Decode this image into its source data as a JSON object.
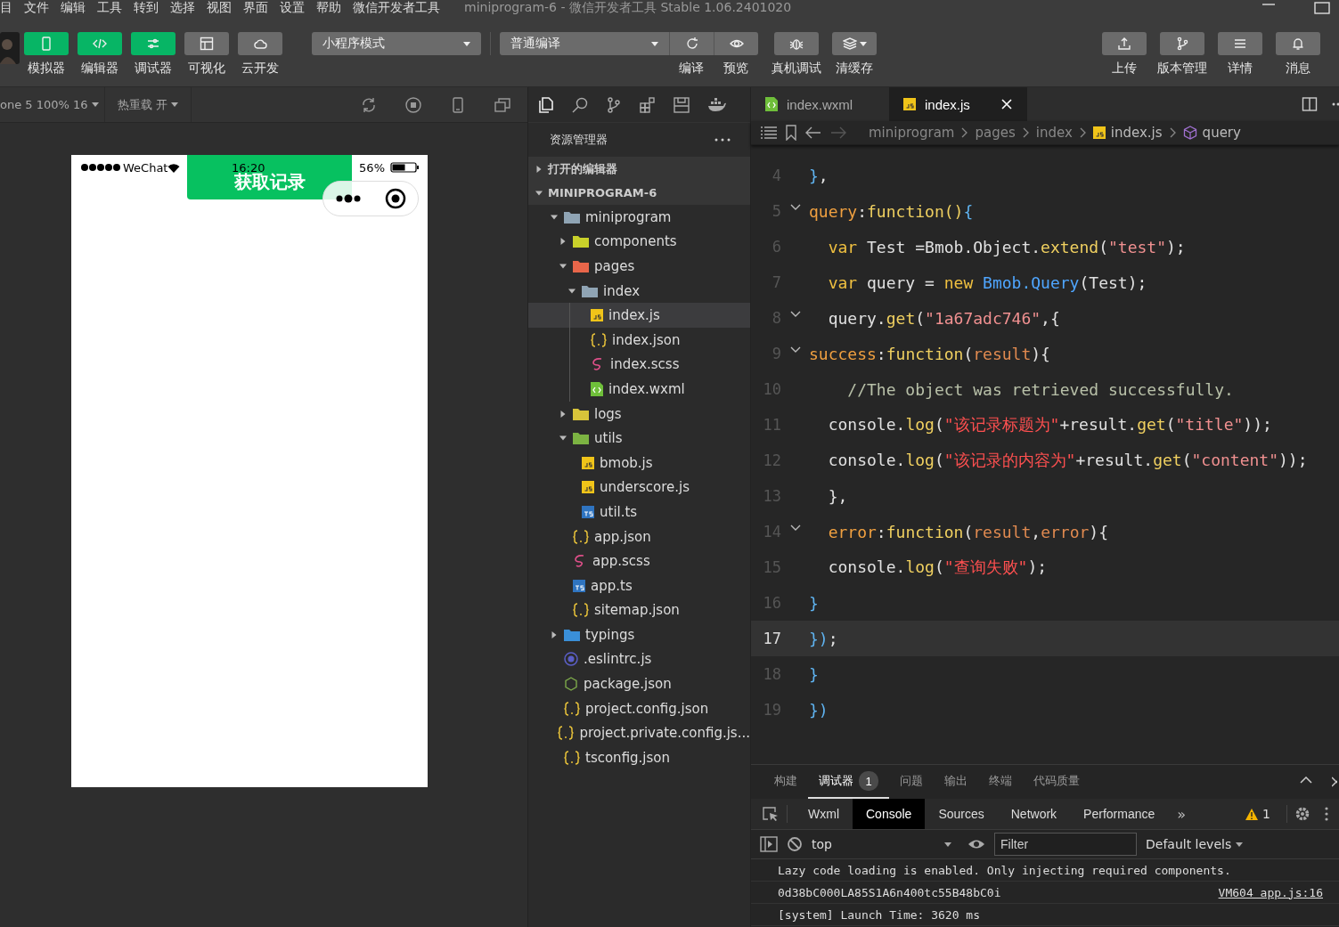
{
  "menu": [
    "目",
    "文件",
    "编辑",
    "工具",
    "转到",
    "选择",
    "视图",
    "界面",
    "设置",
    "帮助",
    "微信开发者工具"
  ],
  "window": {
    "title": "miniprogram-6 - 微信开发者工具 Stable 1.06.2401020"
  },
  "toolbar": {
    "view_buttons": [
      {
        "label": "模拟器",
        "selected": true
      },
      {
        "label": "编辑器",
        "selected": true
      },
      {
        "label": "调试器",
        "selected": true
      },
      {
        "label": "可视化",
        "selected": false
      },
      {
        "label": "云开发",
        "selected": false
      }
    ],
    "mode": "小程序模式",
    "compile_mode": "普通编译",
    "compile_actions": [
      "编译",
      "预览"
    ],
    "actions": [
      "真机调试",
      "清缓存"
    ],
    "right_actions": [
      "上传",
      "版本管理",
      "详情",
      "消息"
    ]
  },
  "simulator": {
    "device": "one 5 100% 16",
    "hot_reload": "热重载 开",
    "phone": {
      "carrier": "WeChat",
      "time": "16:20",
      "battery": "56%",
      "button": "获取记录"
    }
  },
  "explorer": {
    "title": "资源管理器",
    "sections": [
      {
        "label": "打开的编辑器",
        "expanded": false
      },
      {
        "label": "MINIPROGRAM-6",
        "expanded": true
      }
    ],
    "tree": [
      {
        "name": "miniprogram",
        "kind": "folder",
        "color": "#8fa4b4",
        "expanded": true,
        "selected": false,
        "children": [
          {
            "name": "components",
            "kind": "folder",
            "color": "#c9d12a",
            "expanded": false,
            "selected": false
          },
          {
            "name": "pages",
            "kind": "folder",
            "color": "#e8664a",
            "expanded": true,
            "selected": false,
            "children": [
              {
                "name": "index",
                "kind": "folder",
                "color": "#8fa4b4",
                "expanded": true,
                "selected": false,
                "children": [
                  {
                    "name": "index.js",
                    "kind": "js",
                    "selected": true
                  },
                  {
                    "name": "index.json",
                    "kind": "json",
                    "selected": false
                  },
                  {
                    "name": "index.scss",
                    "kind": "scss",
                    "selected": false
                  },
                  {
                    "name": "index.wxml",
                    "kind": "wxml",
                    "selected": false
                  }
                ]
              }
            ]
          },
          {
            "name": "logs",
            "kind": "folder",
            "color": "#d8c43a",
            "expanded": false,
            "selected": false
          },
          {
            "name": "utils",
            "kind": "folder",
            "color": "#7cb342",
            "expanded": true,
            "selected": false,
            "children": [
              {
                "name": "bmob.js",
                "kind": "js",
                "selected": false
              },
              {
                "name": "underscore.js",
                "kind": "js",
                "selected": false
              },
              {
                "name": "util.ts",
                "kind": "ts",
                "selected": false
              }
            ]
          },
          {
            "name": "app.json",
            "kind": "json",
            "selected": false
          },
          {
            "name": "app.scss",
            "kind": "scss",
            "selected": false
          },
          {
            "name": "app.ts",
            "kind": "ts",
            "selected": false
          },
          {
            "name": "sitemap.json",
            "kind": "json",
            "selected": false
          }
        ]
      },
      {
        "name": "typings",
        "kind": "folder",
        "color": "#3a8fd8",
        "expanded": false,
        "selected": false
      },
      {
        "name": ".eslintrc.js",
        "kind": "eslint",
        "selected": false
      },
      {
        "name": "package.json",
        "kind": "npm",
        "selected": false
      },
      {
        "name": "project.config.json",
        "kind": "json",
        "selected": false
      },
      {
        "name": "project.private.config.js...",
        "kind": "json",
        "selected": false
      },
      {
        "name": "tsconfig.json",
        "kind": "json",
        "selected": false
      }
    ]
  },
  "editor": {
    "tabs": [
      {
        "label": "index.wxml",
        "kind": "wxml",
        "selected": false
      },
      {
        "label": "index.js",
        "kind": "js",
        "selected": true
      }
    ],
    "breadcrumb": [
      {
        "label": "miniprogram",
        "kind": "folder"
      },
      {
        "label": "pages",
        "kind": "folder"
      },
      {
        "label": "index",
        "kind": "folder"
      },
      {
        "label": "index.js",
        "kind": "js"
      },
      {
        "label": "query",
        "kind": "symbol"
      }
    ],
    "lines": [
      {
        "number": "4",
        "fold": false,
        "current": false,
        "tokens": [
          {
            "kind": "brace",
            "text": "}"
          },
          {
            "kind": "plain",
            "text": ","
          }
        ]
      },
      {
        "number": "5",
        "fold": true,
        "current": false,
        "tokens": [
          {
            "kind": "prop",
            "text": "query"
          },
          {
            "kind": "plain",
            "text": ":"
          },
          {
            "kind": "fn",
            "text": "function"
          },
          {
            "kind": "fn",
            "text": "()"
          },
          {
            "kind": "brace",
            "text": "{"
          }
        ]
      },
      {
        "number": "6",
        "fold": false,
        "current": false,
        "tokens": [
          {
            "kind": "kw",
            "text": "  var"
          },
          {
            "kind": "plain",
            "text": " Test =Bmob.Object."
          },
          {
            "kind": "fn",
            "text": "extend"
          },
          {
            "kind": "plain",
            "text": "("
          },
          {
            "kind": "str",
            "text": "\"test\""
          },
          {
            "kind": "plain",
            "text": ");"
          }
        ]
      },
      {
        "number": "7",
        "fold": false,
        "current": false,
        "tokens": [
          {
            "kind": "kw",
            "text": "  var"
          },
          {
            "kind": "plain",
            "text": " query = "
          },
          {
            "kind": "kw",
            "text": "new"
          },
          {
            "kind": "cls",
            "text": " Bmob.Query"
          },
          {
            "kind": "plain",
            "text": "(Test);"
          }
        ]
      },
      {
        "number": "8",
        "fold": true,
        "current": false,
        "tokens": [
          {
            "kind": "plain",
            "text": "  query."
          },
          {
            "kind": "fn",
            "text": "get"
          },
          {
            "kind": "plain",
            "text": "("
          },
          {
            "kind": "str",
            "text": "\"1a67adc746\""
          },
          {
            "kind": "plain",
            "text": ",{"
          }
        ]
      },
      {
        "number": "9",
        "fold": true,
        "current": false,
        "tokens": [
          {
            "kind": "prop",
            "text": "success"
          },
          {
            "kind": "plain",
            "text": ":"
          },
          {
            "kind": "fn",
            "text": "function"
          },
          {
            "kind": "plain",
            "text": "("
          },
          {
            "kind": "param",
            "text": "result"
          },
          {
            "kind": "plain",
            "text": "){"
          }
        ]
      },
      {
        "number": "10",
        "fold": false,
        "current": false,
        "tokens": [
          {
            "kind": "comment",
            "text": "    //The object was retrieved successfully."
          }
        ]
      },
      {
        "number": "11",
        "fold": false,
        "current": false,
        "tokens": [
          {
            "kind": "plain",
            "text": "  console."
          },
          {
            "kind": "fn",
            "text": "log"
          },
          {
            "kind": "plain",
            "text": "("
          },
          {
            "kind": "strzh",
            "text": "\"该记录标题为\""
          },
          {
            "kind": "plain",
            "text": "+result."
          },
          {
            "kind": "fn",
            "text": "get"
          },
          {
            "kind": "plain",
            "text": "("
          },
          {
            "kind": "str",
            "text": "\"title\""
          },
          {
            "kind": "plain",
            "text": "));"
          }
        ]
      },
      {
        "number": "12",
        "fold": false,
        "current": false,
        "tokens": [
          {
            "kind": "plain",
            "text": "  console."
          },
          {
            "kind": "fn",
            "text": "log"
          },
          {
            "kind": "plain",
            "text": "("
          },
          {
            "kind": "strzh",
            "text": "\"该记录的内容为\""
          },
          {
            "kind": "plain",
            "text": "+result."
          },
          {
            "kind": "fn",
            "text": "get"
          },
          {
            "kind": "plain",
            "text": "("
          },
          {
            "kind": "str",
            "text": "\"content\""
          },
          {
            "kind": "plain",
            "text": "));"
          }
        ]
      },
      {
        "number": "13",
        "fold": false,
        "current": false,
        "tokens": [
          {
            "kind": "plain",
            "text": "  },"
          }
        ]
      },
      {
        "number": "14",
        "fold": true,
        "current": false,
        "tokens": [
          {
            "kind": "prop",
            "text": "  error"
          },
          {
            "kind": "plain",
            "text": ":"
          },
          {
            "kind": "fn",
            "text": "function"
          },
          {
            "kind": "plain",
            "text": "("
          },
          {
            "kind": "param",
            "text": "result"
          },
          {
            "kind": "plain",
            "text": ","
          },
          {
            "kind": "param",
            "text": "error"
          },
          {
            "kind": "plain",
            "text": "){"
          }
        ]
      },
      {
        "number": "15",
        "fold": false,
        "current": false,
        "tokens": [
          {
            "kind": "plain",
            "text": "  console."
          },
          {
            "kind": "fn",
            "text": "log"
          },
          {
            "kind": "plain",
            "text": "("
          },
          {
            "kind": "strzh",
            "text": "\"查询失败\""
          },
          {
            "kind": "plain",
            "text": ");"
          }
        ]
      },
      {
        "number": "16",
        "fold": false,
        "current": false,
        "tokens": [
          {
            "kind": "brace",
            "text": "}"
          }
        ]
      },
      {
        "number": "17",
        "fold": false,
        "current": true,
        "tokens": [
          {
            "kind": "brace",
            "text": "})"
          },
          {
            "kind": "plain",
            "text": ";"
          }
        ]
      },
      {
        "number": "18",
        "fold": false,
        "current": false,
        "tokens": [
          {
            "kind": "brace",
            "text": "}"
          }
        ]
      },
      {
        "number": "19",
        "fold": false,
        "current": false,
        "tokens": [
          {
            "kind": "brace",
            "text": "})"
          }
        ]
      }
    ]
  },
  "panel": {
    "tabs": [
      {
        "label": "构建",
        "selected": false
      },
      {
        "label": "调试器",
        "selected": true,
        "badge": "1"
      },
      {
        "label": "问题",
        "selected": false
      },
      {
        "label": "输出",
        "selected": false
      },
      {
        "label": "终端",
        "selected": false
      },
      {
        "label": "代码质量",
        "selected": false
      }
    ],
    "devtools_tabs": [
      {
        "label": "Wxml",
        "selected": false
      },
      {
        "label": "Console",
        "selected": true
      },
      {
        "label": "Sources",
        "selected": false
      },
      {
        "label": "Network",
        "selected": false
      },
      {
        "label": "Performance",
        "selected": false
      }
    ],
    "more": "»",
    "warnings": "1",
    "console": {
      "context": "top",
      "filter_placeholder": "Filter",
      "levels": "Default levels",
      "messages": [
        {
          "text": "Lazy code loading is enabled. Only injecting required components."
        },
        {
          "text": "0d38bC000LA85S1A6n400tc55B48bC0i",
          "source": "VM604 app.js:16"
        },
        {
          "text": "[system] Launch Time: 3620 ms"
        }
      ]
    }
  }
}
